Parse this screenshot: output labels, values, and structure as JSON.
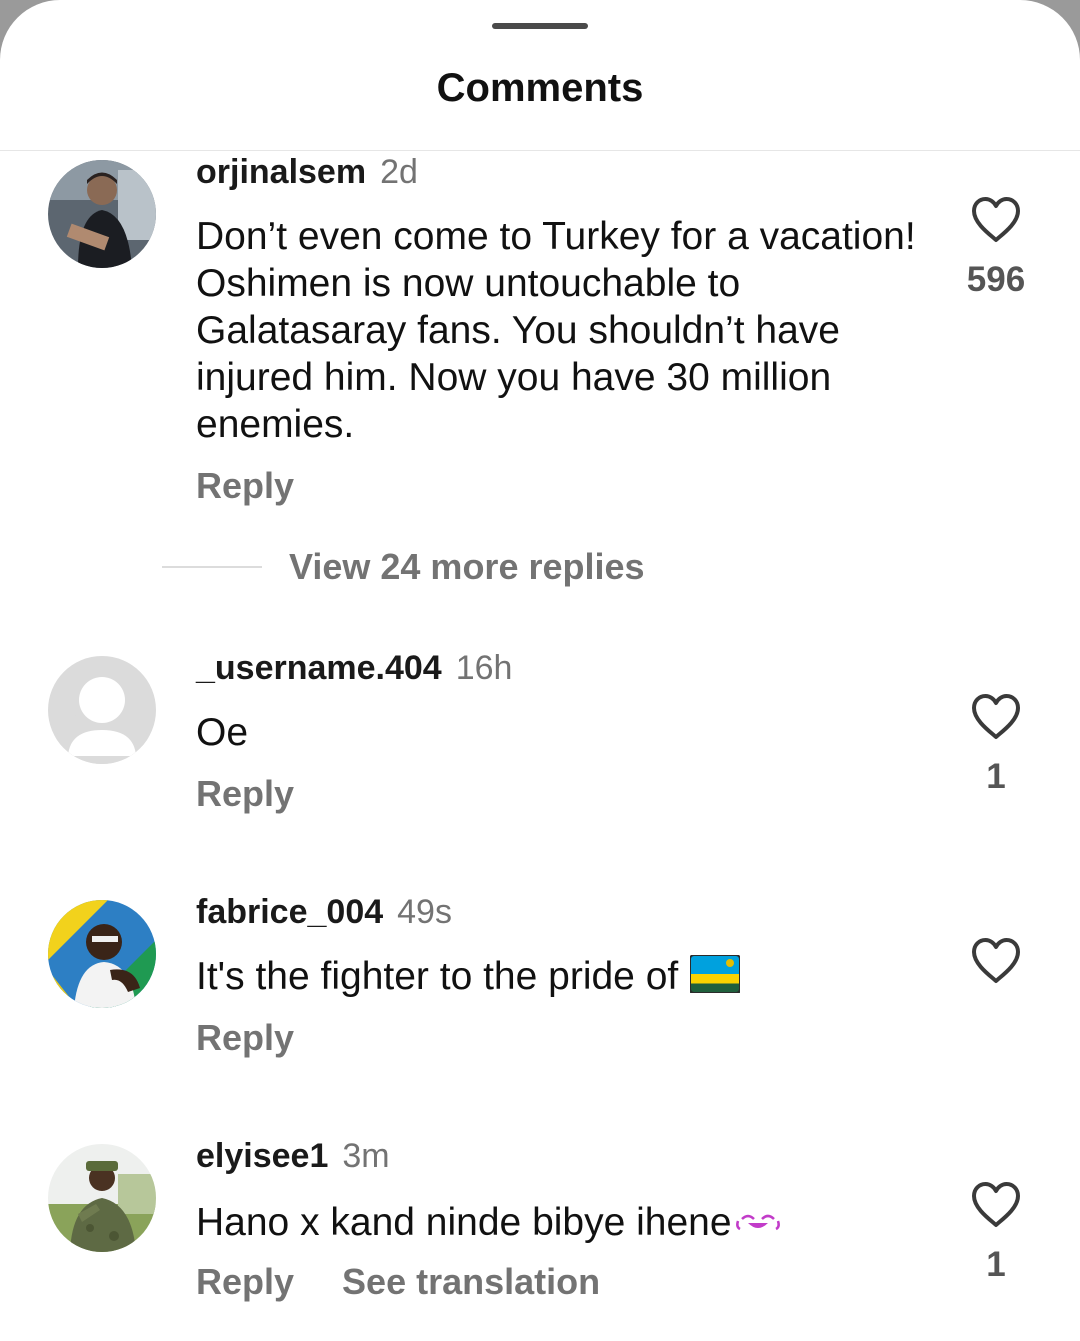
{
  "header": {
    "title": "Comments"
  },
  "comments": [
    {
      "username": "orjinalsem",
      "time": "2d",
      "text": "Don’t even come to Turkey for a vacation! Oshimen is now untouchable to Galatasaray fans. You shouldn’t have injured him. Now you have 30 million enemies.",
      "reply_label": "Reply",
      "likes": "596",
      "view_replies": "View 24 more replies"
    },
    {
      "username": "_username.404",
      "time": "16h",
      "text": "Oe",
      "reply_label": "Reply",
      "likes": "1"
    },
    {
      "username": "fabrice_004",
      "time": "49s",
      "text": "It's the fighter to the pride of",
      "reply_label": "Reply",
      "likes": ""
    },
    {
      "username": "elyisee1",
      "time": "3m",
      "text": "Hano x kand ninde bibye ihene",
      "reply_label": "Reply",
      "see_translation": "See translation",
      "likes": "1"
    }
  ],
  "icons": {
    "like": "heart-outline-icon",
    "flag": "rwanda-flag-emoji",
    "emoji": "crying-laughing-emoji"
  },
  "colors": {
    "secondary_text": "#737373",
    "primary_text": "#111111",
    "background": "#ffffff"
  }
}
